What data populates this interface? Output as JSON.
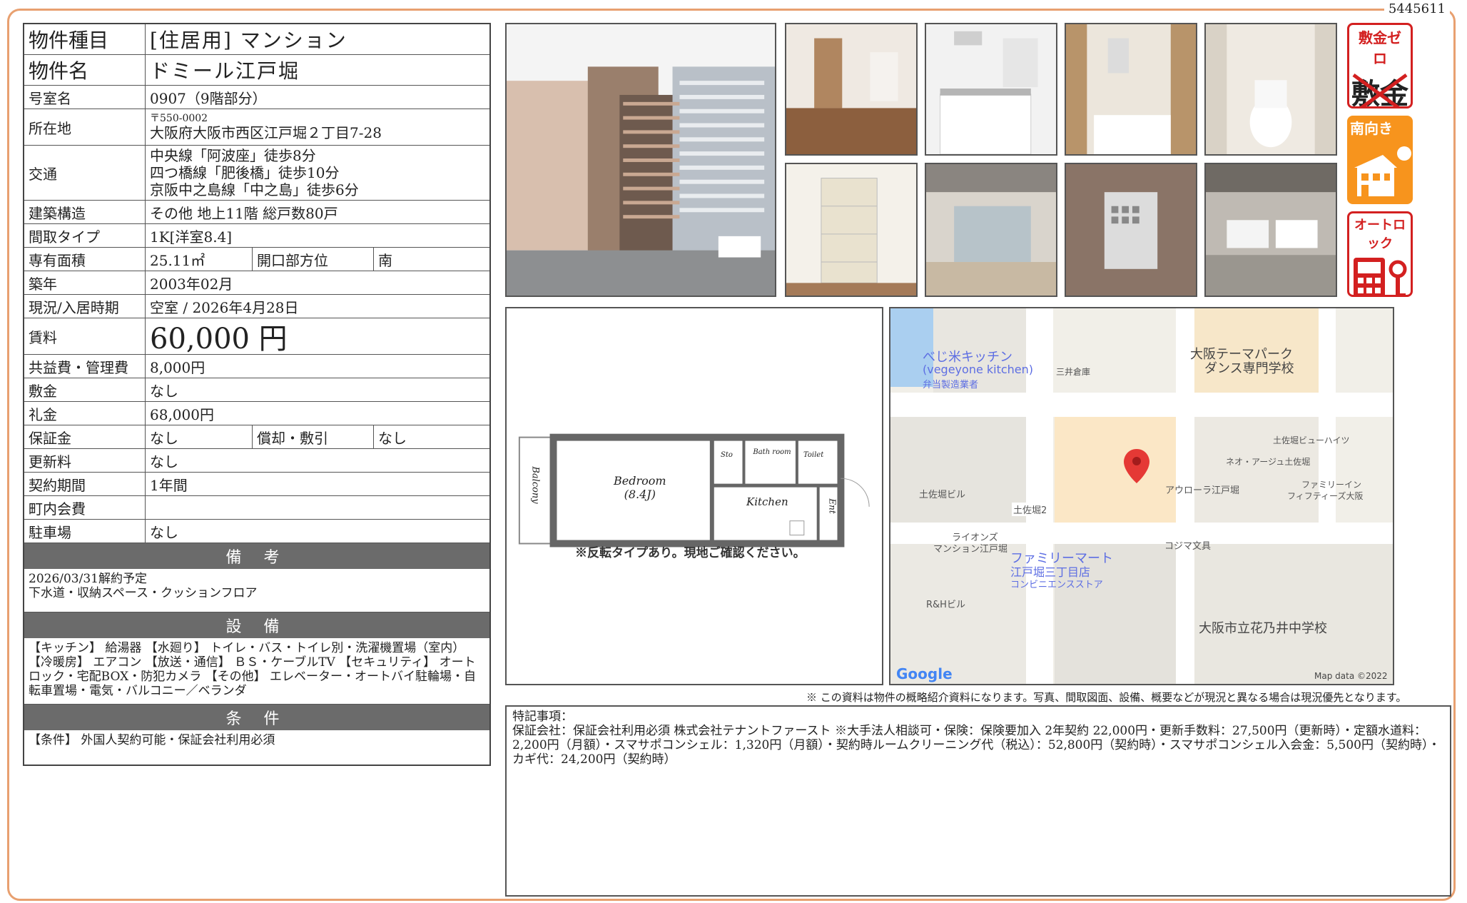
{
  "doc_id": "5445611",
  "info": {
    "type_label": "物件種目",
    "type_value": "[住居用] マンション",
    "name_label": "物件名",
    "name_value": "ドミール江戸堀",
    "room_label": "号室名",
    "room_value": "0907（9階部分）",
    "addr_label": "所在地",
    "addr_zip": "〒550-0002",
    "addr_value": "大阪府大阪市西区江戸堀２丁目7-28",
    "transit_label": "交通",
    "transit": [
      "中央線「阿波座」徒歩8分",
      "四つ橋線「肥後橋」徒歩10分",
      "京阪中之島線「中之島」徒歩6分"
    ],
    "struct_label": "建築構造",
    "struct_value": "その他 地上11階 総戸数80戸",
    "layout_label": "間取タイプ",
    "layout_value": "1K[洋室8.4]",
    "area_label": "専有面積",
    "area_value": "25.11㎡",
    "dir_label": "開口部方位",
    "dir_value": "南",
    "built_label": "築年",
    "built_value": "2003年02月",
    "status_label": "現況/入居時期",
    "status_value": "空室 / 2026年4月28日",
    "rent_label": "賃料",
    "rent_value": "60,000 円",
    "fee_label": "共益費・管理費",
    "fee_value": "8,000円",
    "deposit_label": "敷金",
    "deposit_value": "なし",
    "key_label": "礼金",
    "key_value": "68,000円",
    "guar_label": "保証金",
    "guar_value": "なし",
    "amort_label": "償却・敷引",
    "amort_value": "なし",
    "renew_label": "更新料",
    "renew_value": "なし",
    "term_label": "契約期間",
    "term_value": "1年間",
    "assoc_label": "町内会費",
    "assoc_value": "",
    "parking_label": "駐車場",
    "parking_value": "なし"
  },
  "remarks": {
    "title": "備 考",
    "lines": [
      "2026/03/31解約予定",
      "下水道・収納スペース・クッションフロア"
    ]
  },
  "equipment": {
    "title": "設 備",
    "text": "【キッチン】 給湯器 【水廻り】 トイレ・バス・トイレ別・洗濯機置場（室内） 【冷暖房】 エアコン 【放送・通信】 ＢＳ・ケーブルTV 【セキュリティ】 オートロック・宅配BOX・防犯カメラ 【その他】 エレベーター・オートバイ駐輪場・自転車置場・電気・バルコニー／ベランダ"
  },
  "conditions": {
    "title": "条 件",
    "text": "【条件】 外国人契約可能・保証会社利用必須"
  },
  "badges": {
    "b1_top": "敷金ゼロ",
    "b1_main": "敷金",
    "b2_top": "南向き",
    "b3_top": "オートロック"
  },
  "plan": {
    "bedroom": "Bedroom",
    "bedroom_size": "(8.4J)",
    "balcony": "Balcony",
    "sto": "Sto",
    "bath": "Bath room",
    "toilet": "Toilet",
    "kitchen": "Kitchen",
    "ent": "Ent",
    "note": "※反転タイプあり。現地ご確認ください。"
  },
  "map": {
    "labels": [
      "べじ米キッチン",
      "(vegeyone kitchen)",
      "弁当製造業者",
      "三井倉庫",
      "大阪テーマパーク",
      "ダンス専門学校",
      "土佐堀ビューハイツ",
      "ネオ・アージュ土佐堀",
      "ファミリーイン",
      "フィフティーズ大阪",
      "アウローラ江戸堀",
      "土佐堀ビル",
      "土佐堀2",
      "ライオンズ",
      "マンション江戸堀",
      "ファミリーマート",
      "江戸堀三丁目店",
      "コンビニエンスストア",
      "コジマ文具",
      "R&Hビル",
      "大阪市立花乃井中学校"
    ],
    "google": "Google",
    "credit": "Map data ©2022"
  },
  "disclaimer": "※ この資料は物件の概略紹介資料になります。写真、間取図面、設備、概要などが現況と異なる場合は現況優先となります。",
  "notes": {
    "title": "特記事項：",
    "text": "保証会社：保証会社利用必須 株式会社テナントファースト ※大手法人相談可・保険：保険要加入 2年契約 22,000円・更新手数料：27,500円（更新時）・定額水道料：2,200円（月額）・スマサポコンシェル：1,320円（月額）・契約時ルームクリーニング代（税込）：52,800円（契約時）・スマサポコンシェル入会金：5,500円（契約時）・カギ代：24,200円（契約時）"
  }
}
